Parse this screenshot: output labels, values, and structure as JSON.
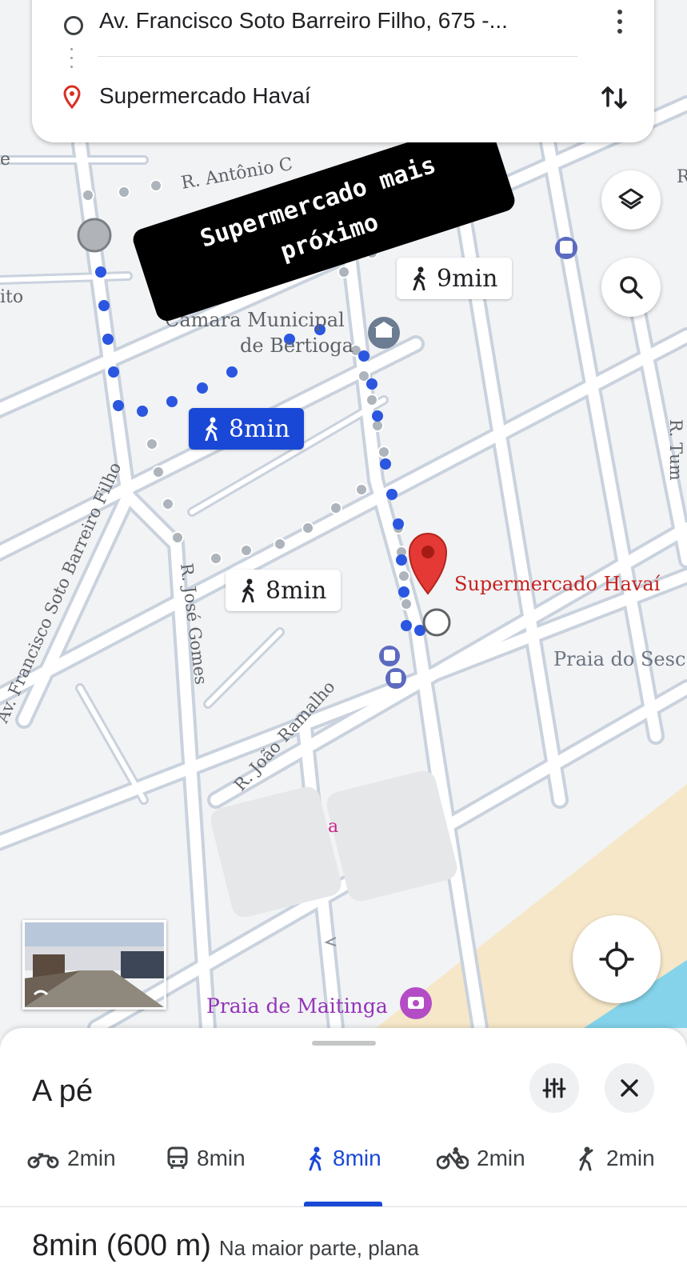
{
  "search": {
    "origin": "Av. Francisco Soto Barreiro Filho, 675 -...",
    "destination": "Supermercado Havaí"
  },
  "map_labels": {
    "street_antonio": "R. Antônio C",
    "camara": "Câmara Municipal",
    "camara2": "de Bertioga",
    "av_francisco": "Av. Francisco Soto Barreiro Filho",
    "rua_jose_gomes": "R. José Gomes",
    "rua_joao_ramalho": "R. João Ramalho",
    "supermercado": "Supermercado Havaí",
    "praia_sesc": "Praia do Sesc",
    "praia_maitinga": "Praia de Maitinga",
    "edge_e": "e",
    "edge_ito": "ito",
    "edge_r": "R",
    "edge_rtum": "R. Tum",
    "blurred_a": "a"
  },
  "sticker": {
    "line1": "Supermercado mais",
    "line2": "próximo"
  },
  "routes": [
    {
      "label": "8min",
      "selected": true
    },
    {
      "label": "9min",
      "selected": false
    },
    {
      "label": "8min",
      "selected": false
    }
  ],
  "sheet": {
    "title": "A pé",
    "modes": [
      {
        "icon": "motorcycle-icon",
        "label": "2min"
      },
      {
        "icon": "transit-icon",
        "label": "8min"
      },
      {
        "icon": "walk-icon",
        "label": "8min",
        "active": true
      },
      {
        "icon": "bike-icon",
        "label": "2min"
      },
      {
        "icon": "ride-hail-icon",
        "label": "2min"
      }
    ],
    "summary_main": "8min (600 m)",
    "summary_sub": "Na maior parte, plana"
  },
  "colors": {
    "route_blue": "#1a48d6",
    "route_dot": "#2a56e0",
    "alt_dot": "#aeb4bb",
    "pin_red": "#e53935",
    "poi_purple": "#9334b8",
    "beach": "#f6e7c8",
    "sea": "#7fd0e8"
  }
}
